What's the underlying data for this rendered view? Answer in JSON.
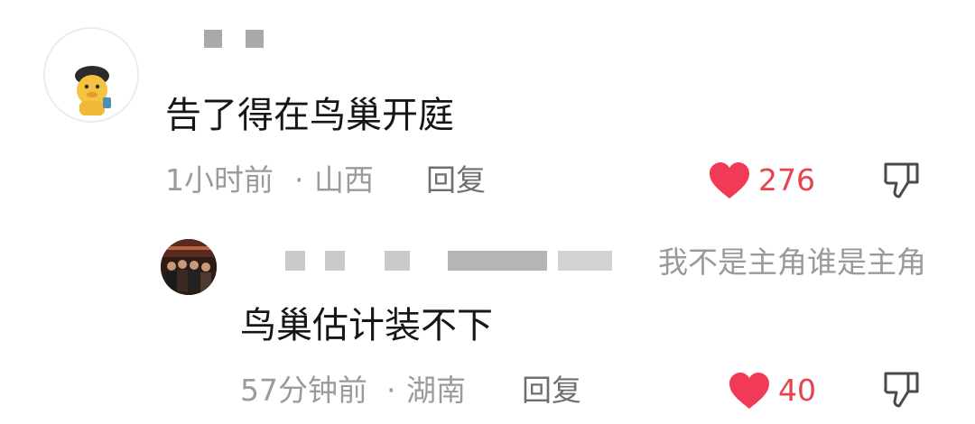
{
  "comment": {
    "text": "告了得在鸟巢开庭",
    "time": "1小时前",
    "separator": "·",
    "location": "山西",
    "reply_label": "回复",
    "likes": "276",
    "avatar_icon": "cartoon-duck-avatar",
    "like_icon": "heart-icon",
    "dislike_icon": "thumbs-down-icon"
  },
  "reply": {
    "quote_visible_text": "我不是主角谁是主角",
    "text": "鸟巢估计装不下",
    "time": "57分钟前",
    "separator": "·",
    "location": "湖南",
    "reply_label": "回复",
    "likes": "40",
    "avatar_icon": "group-photo-avatar",
    "like_icon": "heart-icon",
    "dislike_icon": "thumbs-down-icon"
  },
  "colors": {
    "like_red": "#f03a57",
    "meta_gray": "#9b9b9b",
    "text_dark": "#161616"
  }
}
